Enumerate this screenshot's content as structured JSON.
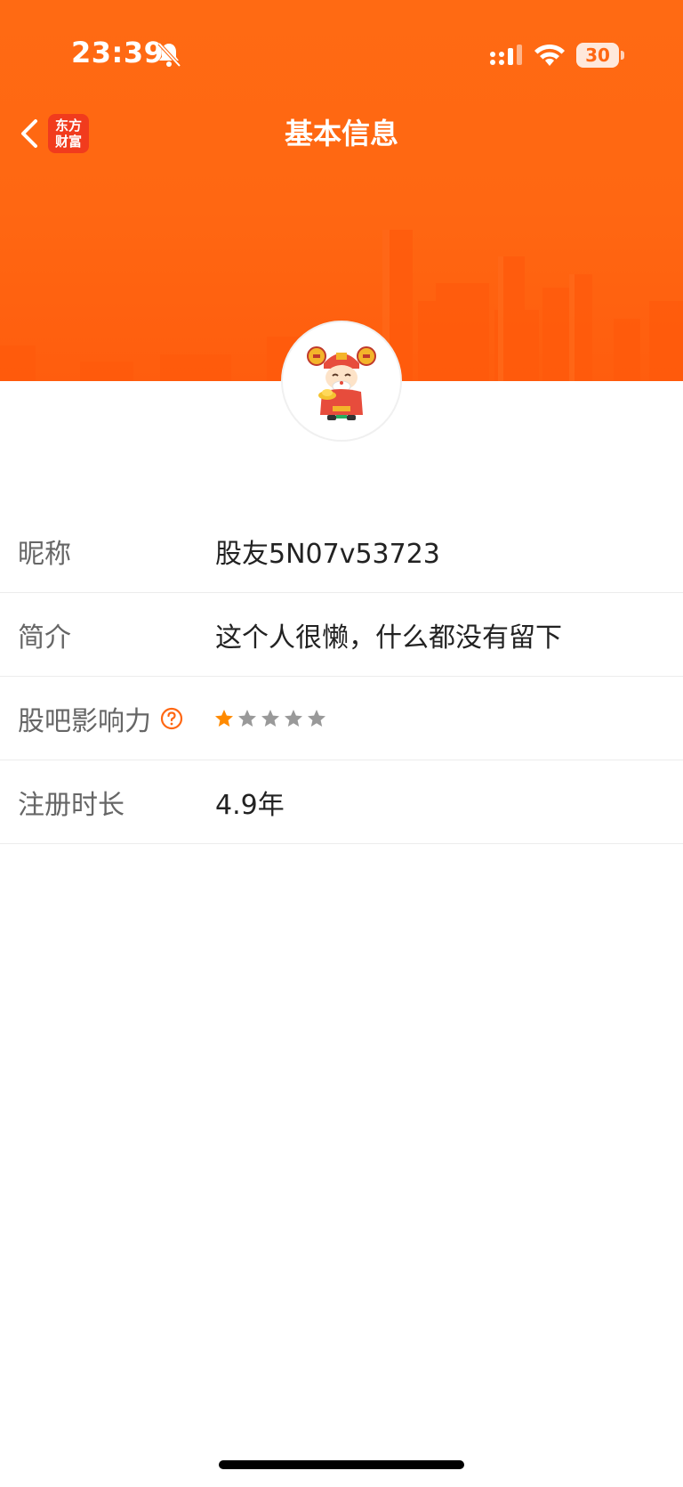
{
  "status_bar": {
    "time": "23:39",
    "battery": "30",
    "icons": [
      "bell-off-icon",
      "signal-icon",
      "wifi-icon",
      "battery-icon"
    ]
  },
  "nav": {
    "title": "基本信息",
    "app_badge_line1": "东方",
    "app_badge_line2": "财富",
    "back_icon": "chevron-left-icon"
  },
  "colors": {
    "brand": "#ff6712",
    "badge": "#f13b1d",
    "star_active": "#ff8a00",
    "star_inactive": "#999999"
  },
  "profile": {
    "rows": [
      {
        "label": "昵称",
        "value": "股友5N07v53723"
      },
      {
        "label": "简介",
        "value": "这个人很懒，什么都没有留下"
      },
      {
        "label": "股吧影响力",
        "rating": 1,
        "max_rating": 5
      },
      {
        "label": "注册时长",
        "value": "4.9年"
      }
    ]
  }
}
